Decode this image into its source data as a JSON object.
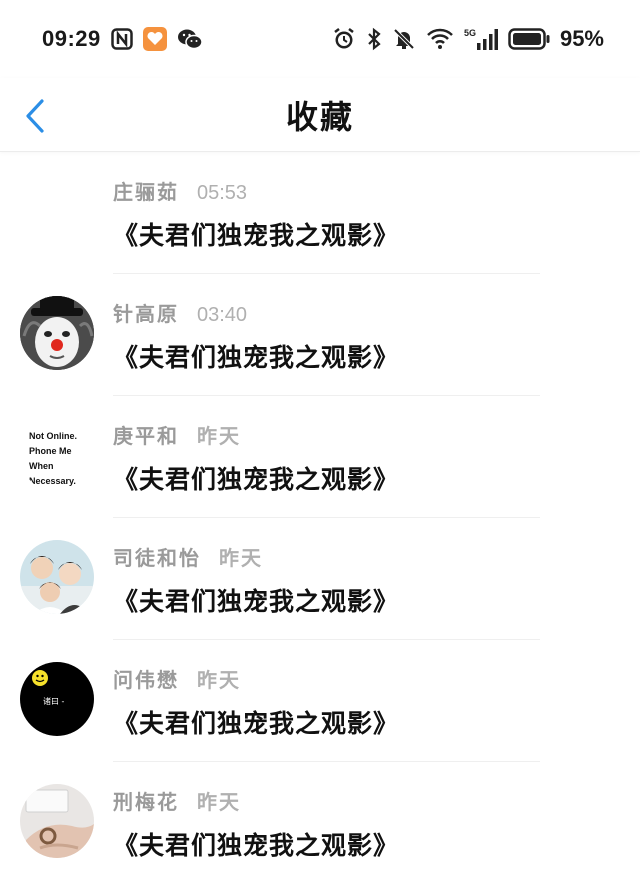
{
  "status_bar": {
    "time": "09:29",
    "battery": "95%",
    "network": "5G",
    "left_icons": [
      "nfc-icon",
      "app-notification-icon",
      "wechat-icon"
    ],
    "right_icons": [
      "alarm-icon",
      "bluetooth-icon",
      "mute-icon",
      "wifi-icon",
      "signal-icon",
      "battery-icon"
    ]
  },
  "header": {
    "title": "收藏",
    "back_icon": "chevron-left-icon",
    "accent": "#2b8ee6"
  },
  "favorites": [
    {
      "name": "庄骊茹",
      "time": "05:53",
      "title": "《夫君们独宠我之观影》",
      "avatar": "none"
    },
    {
      "name": "针高原",
      "time": "03:40",
      "title": "《夫君们独宠我之观影》",
      "avatar": "clown"
    },
    {
      "name": "庚平和",
      "time": "昨天",
      "title": "《夫君们独宠我之观影》",
      "avatar": "text",
      "avatar_text": [
        "Not Online.",
        "Phone Me",
        "When",
        "Necessary."
      ]
    },
    {
      "name": "司徒和怡",
      "time": "昨天",
      "title": "《夫君们独宠我之观影》",
      "avatar": "group-photo"
    },
    {
      "name": "问伟懋",
      "time": "昨天",
      "title": "《夫君们独宠我之观影》",
      "avatar": "black-emoji",
      "avatar_text": [
        "诸曰 -"
      ]
    },
    {
      "name": "刑梅花",
      "time": "昨天",
      "title": "《夫君们独宠我之观影》",
      "avatar": "hand-photo"
    }
  ]
}
